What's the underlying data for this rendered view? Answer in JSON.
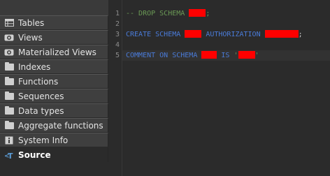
{
  "sidebar": {
    "items": [
      {
        "label": "Tables",
        "icon": "table-icon"
      },
      {
        "label": "Views",
        "icon": "eye-icon"
      },
      {
        "label": "Materialized Views",
        "icon": "eye-icon"
      },
      {
        "label": "Indexes",
        "icon": "folder-icon"
      },
      {
        "label": "Functions",
        "icon": "folder-icon"
      },
      {
        "label": "Sequences",
        "icon": "folder-icon"
      },
      {
        "label": "Data types",
        "icon": "folder-icon"
      },
      {
        "label": "Aggregate functions",
        "icon": "folder-icon"
      },
      {
        "label": "System Info",
        "icon": "info-icon"
      },
      {
        "label": "Source",
        "icon": "source-icon"
      }
    ]
  },
  "editor": {
    "line_numbers": [
      "1",
      "2",
      "3",
      "4",
      "5"
    ],
    "line1": {
      "comment": "-- DROP SCHEMA ",
      "end": ";"
    },
    "line3": {
      "kw1": "CREATE SCHEMA ",
      "kw2": " AUTHORIZATION ",
      "end": ";"
    },
    "line5": {
      "kw1": "COMMENT ON SCHEMA ",
      "kw2": " IS ",
      "q1": "'",
      "q2": "'"
    }
  },
  "colors": {
    "comment": "#6a9955",
    "keyword": "#4a7bd8",
    "redaction": "#ff0000"
  }
}
